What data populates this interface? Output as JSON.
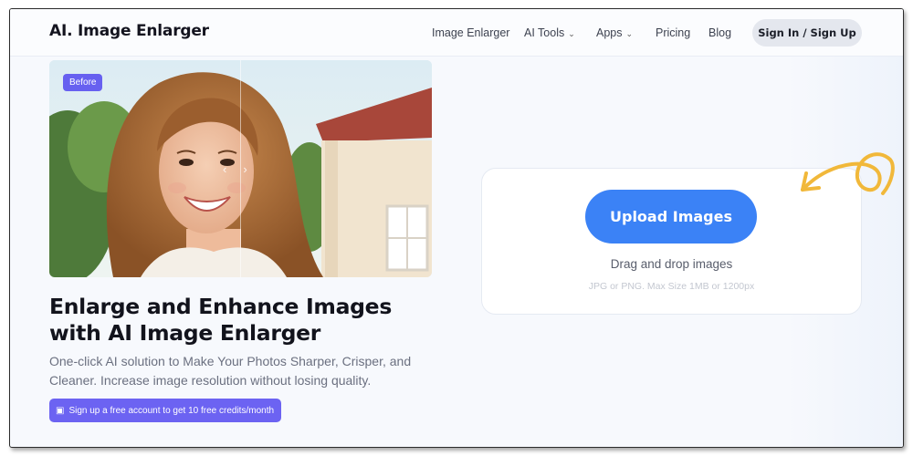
{
  "header": {
    "logo": "AI. Image Enlarger",
    "nav": [
      {
        "label": "Image Enlarger",
        "dropdown": false
      },
      {
        "label": "AI Tools",
        "dropdown": true
      },
      {
        "label": "Apps",
        "dropdown": true
      },
      {
        "label": "Pricing",
        "dropdown": false
      },
      {
        "label": "Blog",
        "dropdown": false
      }
    ],
    "signin_label": "Sign In / Sign Up"
  },
  "hero": {
    "before_badge": "Before",
    "title": "Enlarge and Enhance Images with AI Image Enlarger",
    "description": "One-click AI solution to Make Your Photos Sharper, Crisper, and Cleaner. Increase image resolution without losing quality.",
    "cta_label": "Sign up a free account to get 10 free credits/month"
  },
  "upload": {
    "button_label": "Upload Images",
    "drag_text": "Drag and drop images",
    "format_text": "JPG or PNG. Max Size 1MB or 1200px"
  },
  "colors": {
    "accent_blue": "#3b82f6",
    "badge_purple": "#6760f0",
    "doodle_yellow": "#f1b83a"
  },
  "icons": [
    "chevron-down-icon",
    "gift-icon",
    "curved-arrow-doodle"
  ]
}
